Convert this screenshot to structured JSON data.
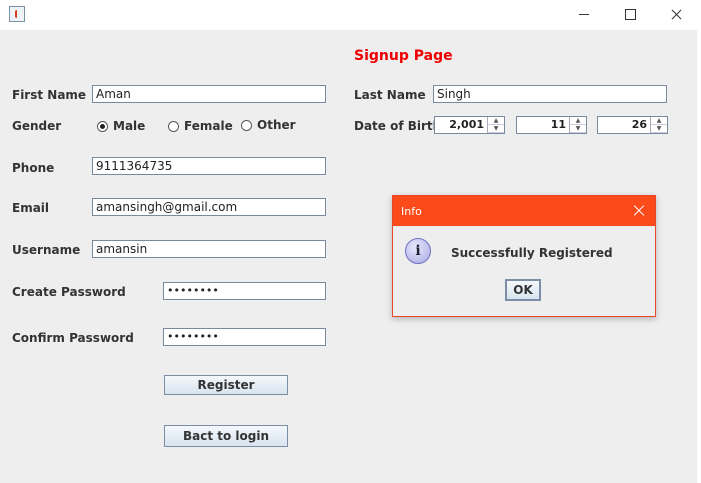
{
  "window": {
    "app_icon": "java-icon",
    "controls": [
      "minimize-icon",
      "maximize-icon",
      "close-icon"
    ]
  },
  "form": {
    "title": "Signup Page",
    "first_name": {
      "label": "First Name",
      "value": "Aman"
    },
    "last_name": {
      "label": "Last Name",
      "value": "Singh"
    },
    "gender": {
      "label": "Gender",
      "options": [
        "Male",
        "Female",
        "Other"
      ],
      "selected": "Male"
    },
    "dob": {
      "label": "Date of Birth",
      "year": "2,001",
      "month": "11",
      "day": "26"
    },
    "phone": {
      "label": "Phone",
      "value": "9111364735"
    },
    "email": {
      "label": "Email",
      "value": "amansingh@gmail.com"
    },
    "username": {
      "label": "Username",
      "value": "amansin"
    },
    "create_password": {
      "label": "Create Password",
      "value": "••••••••"
    },
    "confirm_password": {
      "label": "Confirm Password",
      "value": "••••••••"
    },
    "register_label": "Register",
    "back_label": "Bact to login"
  },
  "dialog": {
    "title": "Info",
    "message": "Successfully Registered",
    "ok_label": "OK",
    "icon": "info-icon"
  },
  "colors": {
    "title_red": "#e00000",
    "dialog_titlebar": "#fc4b1a",
    "window_bg": "#eeeeee"
  }
}
